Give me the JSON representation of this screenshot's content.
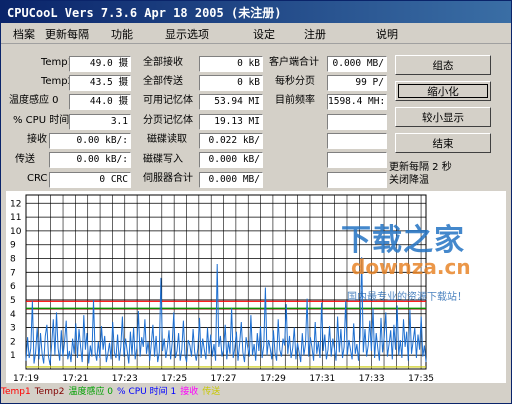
{
  "window": {
    "title": "CPUCooL  Vers 7.3.6  Apr 18 2005 (未注册)"
  },
  "menu": [
    "档案",
    "更新每隔",
    "功能",
    "显示选项",
    "设定",
    "注册",
    "说明"
  ],
  "metrics": {
    "temp1": {
      "label": "Temp1",
      "value": "49.0 摄"
    },
    "temp2": {
      "label": "Temp2",
      "value": "43.5 摄"
    },
    "temp_sensor0": {
      "label": "温度感应 0",
      "value": "44.0 摄"
    },
    "cpu_time": {
      "label": "% CPU 时间",
      "value": "3.1"
    },
    "receive": {
      "label": "接收",
      "value": "0.00 kB/:"
    },
    "send": {
      "label": "传送",
      "value": "0.00 kB/:"
    },
    "crc": {
      "label": "CRC",
      "value": "0 CRC"
    },
    "total_recv": {
      "label": "全部接收",
      "value": "0 kB"
    },
    "total_send": {
      "label": "全部传送",
      "value": "0 kB"
    },
    "avail_mem": {
      "label": "可用记忆体",
      "value": "53.94 MI"
    },
    "page_mem": {
      "label": "分页记忆体",
      "value": "19.13 MI"
    },
    "disk_read": {
      "label": "磁碟读取",
      "value": "0.022 kB/"
    },
    "disk_write": {
      "label": "磁碟写入",
      "value": "0.000 kB/"
    },
    "server_total": {
      "label": "伺服器合计",
      "value": "0.000 MB/"
    },
    "client_total": {
      "label": "客户端合计",
      "value": "0.000 MB/"
    },
    "per_page": {
      "label": "每秒分页",
      "value": "99 P/"
    },
    "cur_freq": {
      "label": "目前频率",
      "value": "1598.4 MH:"
    },
    "blank1": {
      "value": ""
    },
    "blank2": {
      "value": ""
    },
    "blank3": {
      "value": ""
    },
    "blank4": {
      "value": ""
    }
  },
  "buttons": {
    "setup": "组态",
    "minimize": "缩小化",
    "small_display": "较小显示",
    "exit": "结束"
  },
  "status": {
    "update": "更新每隔 2 秒",
    "cooling": "关闭降温"
  },
  "legend": [
    {
      "label": "Temp1",
      "color": "#ff0000"
    },
    {
      "label": "Temp2",
      "color": "#800000"
    },
    {
      "label": "温度感应 0",
      "color": "#00a000"
    },
    {
      "label": "% CPU 时间 1",
      "color": "#0000ff"
    },
    {
      "label": "接收",
      "color": "#ff00ff"
    },
    {
      "label": "传送",
      "color": "#c8c800"
    }
  ],
  "watermark": {
    "brand": "下载之家",
    "url": "downza.cn",
    "slogan": "国内最专业的资源下载站！"
  },
  "chart_data": {
    "type": "line",
    "xlabels": [
      "17:19",
      "17:21",
      "17:23",
      "17:25",
      "17:27",
      "17:29",
      "17:31",
      "17:33",
      "17:35"
    ],
    "ylabels": [
      "12",
      "11",
      "10",
      "9",
      "8",
      "7",
      "6",
      "5",
      "4",
      "3",
      "2",
      "1"
    ],
    "ylim": [
      0,
      12.6
    ],
    "grid": true,
    "hlines": [
      {
        "name": "Temp1",
        "value": 4.9,
        "color": "#ff0000"
      },
      {
        "name": "Temp2",
        "value": 4.35,
        "color": "#800000"
      },
      {
        "name": "温度感应 0",
        "value": 4.4,
        "color": "#00a000"
      },
      {
        "name": "传送",
        "value": 0.15,
        "color": "#c8c800"
      }
    ],
    "series": [
      {
        "name": "% CPU 时间 1",
        "color": "#1e6fd0",
        "values": [
          0.6,
          2.3,
          0.8,
          1.5,
          4.9,
          0.4,
          1.2,
          3.0,
          0.7,
          2.6,
          1.1,
          0.4,
          2.4,
          3.2,
          0.9,
          0.3,
          1.8,
          3.6,
          1.0,
          4.1,
          1.5,
          0.6,
          2.8,
          0.9,
          2.0,
          3.5,
          0.7,
          1.3,
          0.5,
          2.2,
          1.1,
          3.3,
          0.8,
          2.9,
          1.6,
          0.5,
          3.9,
          1.4,
          2.6,
          0.4,
          1.7,
          0.9,
          5.0,
          1.2,
          0.6,
          2.0,
          0.8,
          3.1,
          1.4,
          2.4,
          0.5,
          1.1,
          1.9,
          0.7,
          3.4,
          1.2,
          0.8,
          2.5,
          0.6,
          1.6,
          3.8,
          0.9,
          2.2,
          1.3,
          0.4,
          2.7,
          1.0,
          3.0,
          0.7,
          1.5,
          4.2,
          0.9,
          2.3,
          1.6,
          3.6,
          1.1,
          2.0,
          0.6,
          1.8,
          3.2,
          0.9,
          2.4,
          0.5,
          1.2,
          6.6,
          1.3,
          2.2,
          0.8,
          1.6,
          2.8,
          0.7,
          1.9,
          4.1,
          0.8,
          1.3,
          2.6,
          0.6,
          1.4,
          3.5,
          1.0,
          0.5,
          2.1,
          1.7,
          0.9,
          2.9,
          1.2,
          0.6,
          1.5,
          3.7,
          0.8,
          2.2,
          1.4,
          0.7,
          3.0,
          1.1,
          2.5,
          0.9,
          1.8,
          0.6,
          7.6,
          1.6,
          2.4,
          0.9,
          1.4,
          3.2,
          0.7,
          2.0,
          1.1,
          4.4,
          0.8,
          1.5,
          2.7,
          0.6,
          1.9,
          3.4,
          1.2,
          0.5,
          2.3,
          1.6,
          0.9,
          3.9,
          1.0,
          1.8,
          0.6,
          2.6,
          1.3,
          3.1,
          0.8,
          1.7,
          5.9,
          1.0,
          2.1,
          1.5,
          0.7,
          2.8,
          1.2,
          0.6,
          3.6,
          1.4,
          0.9,
          2.2,
          1.7,
          4.7,
          1.1,
          2.4,
          0.8,
          1.5,
          3.0,
          0.7,
          1.9,
          1.2,
          0.5,
          2.6,
          1.0,
          1.8,
          5.1,
          0.9,
          2.3,
          1.6,
          0.6,
          3.4,
          1.1,
          2.0,
          0.8,
          4.8,
          1.3,
          2.5,
          0.7,
          1.4,
          3.1,
          0.9,
          2.2,
          1.5,
          0.6,
          3.8,
          1.2,
          2.9,
          0.8,
          1.6,
          4.9,
          1.0,
          2.1,
          1.4,
          0.7,
          3.3,
          1.1,
          1.8,
          0.6,
          2.4,
          8.1,
          1.2,
          2.9,
          0.9,
          1.7,
          3.5,
          1.3,
          4.4,
          0.8,
          2.6,
          1.5,
          0.6,
          3.7,
          1.2,
          2.3,
          4.1,
          0.9,
          1.8,
          2.8,
          0.7,
          3.2,
          1.4,
          4.6,
          1.0,
          2.1,
          0.8,
          3.6,
          1.6,
          2.7,
          0.6,
          4.3,
          1.1,
          2.0,
          3.0,
          0.8,
          2.5,
          1.4,
          3.8,
          0.9,
          1.7,
          0.5
        ]
      }
    ]
  }
}
